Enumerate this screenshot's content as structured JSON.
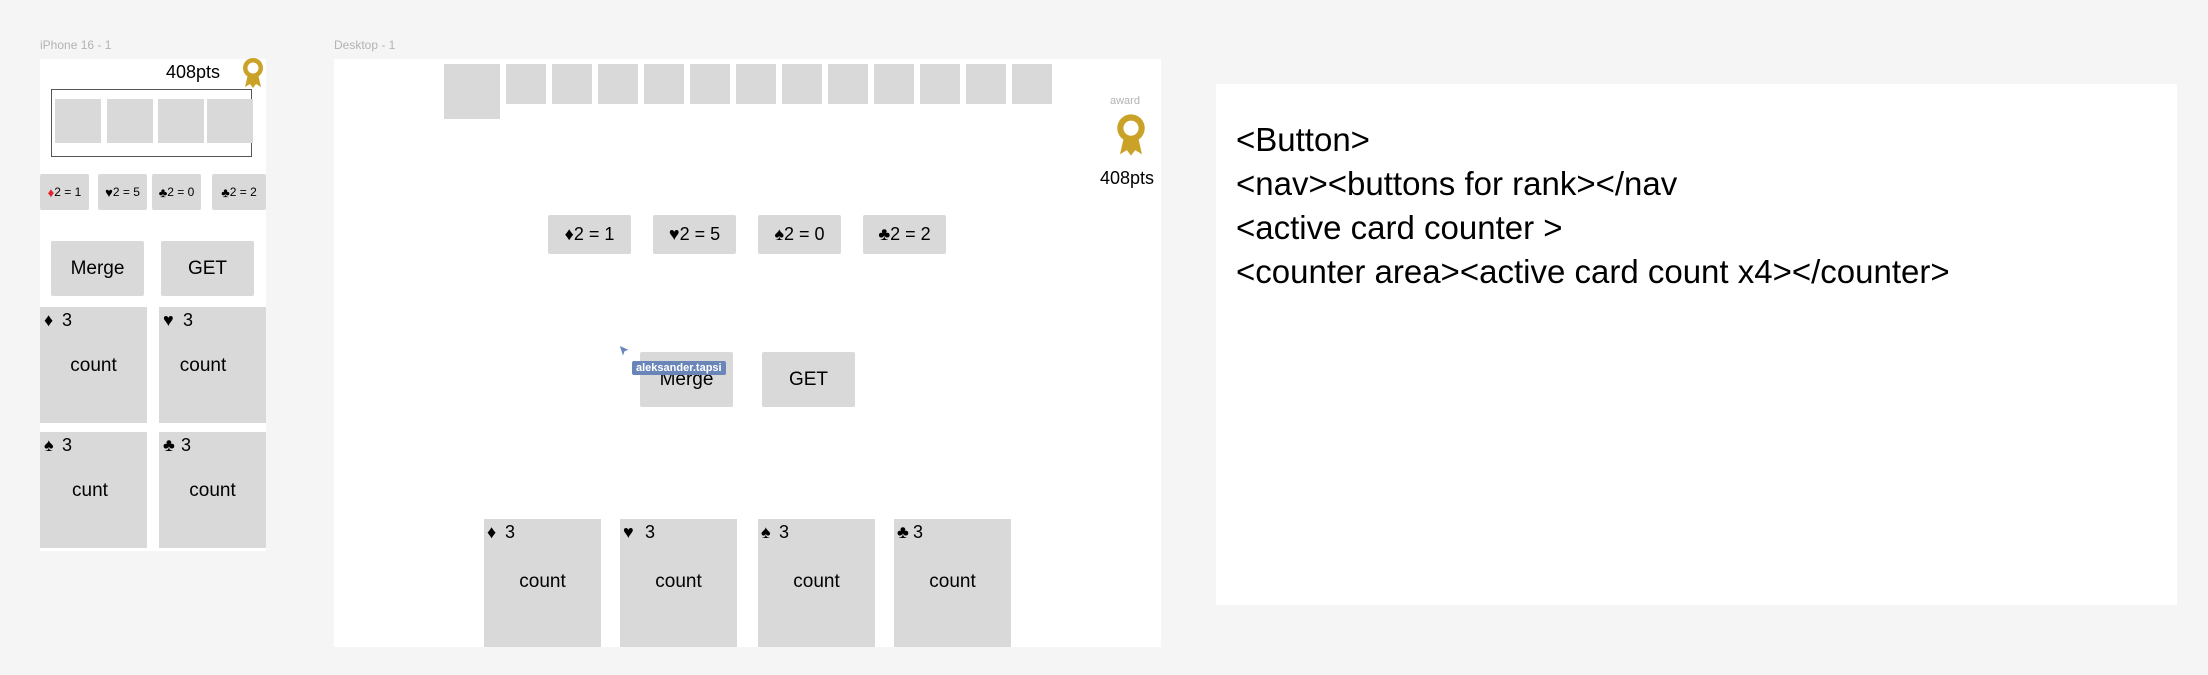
{
  "colors": {
    "canvas": "#f5f5f5",
    "frame": "#ffffff",
    "gray": "#d9d9d9",
    "award": "#c9a227",
    "cursor_label_bg": "#6a85b8"
  },
  "mobile": {
    "frame_label": "iPhone 16 - 1",
    "points": "408pts",
    "award_icon": "award-ribbon-icon",
    "rank_buttons": [
      {
        "suit": "♦",
        "label": "2 = 1"
      },
      {
        "suit": "♥",
        "label": "2 = 5"
      },
      {
        "suit": "♣",
        "label": "2 = 0"
      },
      {
        "suit": "♣",
        "label": "2 = 2"
      }
    ],
    "merge_label": "Merge",
    "get_label": "GET",
    "counters": [
      {
        "suit": "♦",
        "count": "3",
        "label": "count"
      },
      {
        "suit": "♥",
        "count": "3",
        "label": "count"
      },
      {
        "suit": "♠",
        "count": "3",
        "label": "cunt"
      },
      {
        "suit": "♣",
        "count": "3",
        "label": "count"
      }
    ]
  },
  "desktop": {
    "frame_label": "Desktop - 1",
    "award_label": "award",
    "points": "408pts",
    "award_icon": "award-ribbon-icon",
    "rank_buttons": [
      {
        "suit": "♦",
        "label": "2 = 1"
      },
      {
        "suit": "♥",
        "label": "2 = 5"
      },
      {
        "suit": "♠",
        "label": "2 = 0"
      },
      {
        "suit": "♣",
        "label": "2 = 2"
      }
    ],
    "merge_label": "Merge",
    "get_label": "GET",
    "cursor_user": "aleksander.tapsi",
    "counters": [
      {
        "suit": "♦",
        "count": "3",
        "label": "count"
      },
      {
        "suit": "♥",
        "count": "3",
        "label": "count"
      },
      {
        "suit": "♠",
        "count": "3",
        "label": "count"
      },
      {
        "suit": "♣",
        "count": "3",
        "label": "count"
      }
    ]
  },
  "notes": {
    "lines": [
      "<Button>",
      "<nav><buttons for rank></nav",
      "<active card counter >",
      "<counter area><active card count x4></counter>"
    ]
  }
}
